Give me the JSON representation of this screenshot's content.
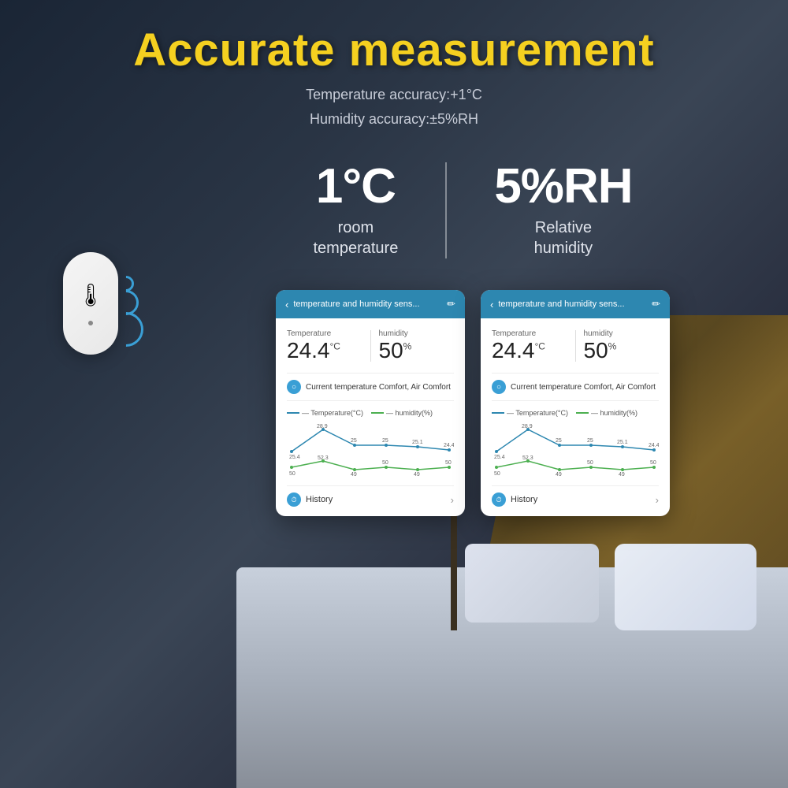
{
  "page": {
    "title": "Accurate measurement",
    "subtitle_line1": "Temperature accuracy:+1°C",
    "subtitle_line2": "Humidity accuracy:±5%RH"
  },
  "stats": {
    "temperature": {
      "value": "1°C",
      "label_line1": "room",
      "label_line2": "temperature"
    },
    "humidity": {
      "value": "5%RH",
      "label_line1": "Relative",
      "label_line2": "humidity"
    }
  },
  "phone_cards": [
    {
      "header_title": "temperature and humidity sens...",
      "temperature_label": "Temperature",
      "temperature_value": "24.4",
      "temperature_unit": "°C",
      "humidity_label": "humidity",
      "humidity_value": "50",
      "humidity_unit": "%",
      "comfort_text": "Current temperature Comfort,  Air Comfort",
      "chart_legend_temp": "— Temperature(°C)",
      "chart_legend_humid": "— humidity(%)",
      "temp_points": "25.4,28.9,25,25,25.1,24.4",
      "humid_points": "50,52.3,49,50,49,50",
      "history_label": "History"
    },
    {
      "header_title": "temperature and humidity sens...",
      "temperature_label": "Temperature",
      "temperature_value": "24.4",
      "temperature_unit": "°C",
      "humidity_label": "humidity",
      "humidity_value": "50",
      "humidity_unit": "%",
      "comfort_text": "Current temperature Comfort,  Air Comfort",
      "chart_legend_temp": "— Temperature(°C)",
      "chart_legend_humid": "— humidity(%)",
      "temp_points": "25.4,28.9,25,25,25.1,24.4",
      "humid_points": "50,52.3,49,50,49,50",
      "history_label": "History"
    }
  ],
  "colors": {
    "title_yellow": "#f5d020",
    "accent_blue": "#2d87b0",
    "bg_dark": "#1a2030"
  }
}
